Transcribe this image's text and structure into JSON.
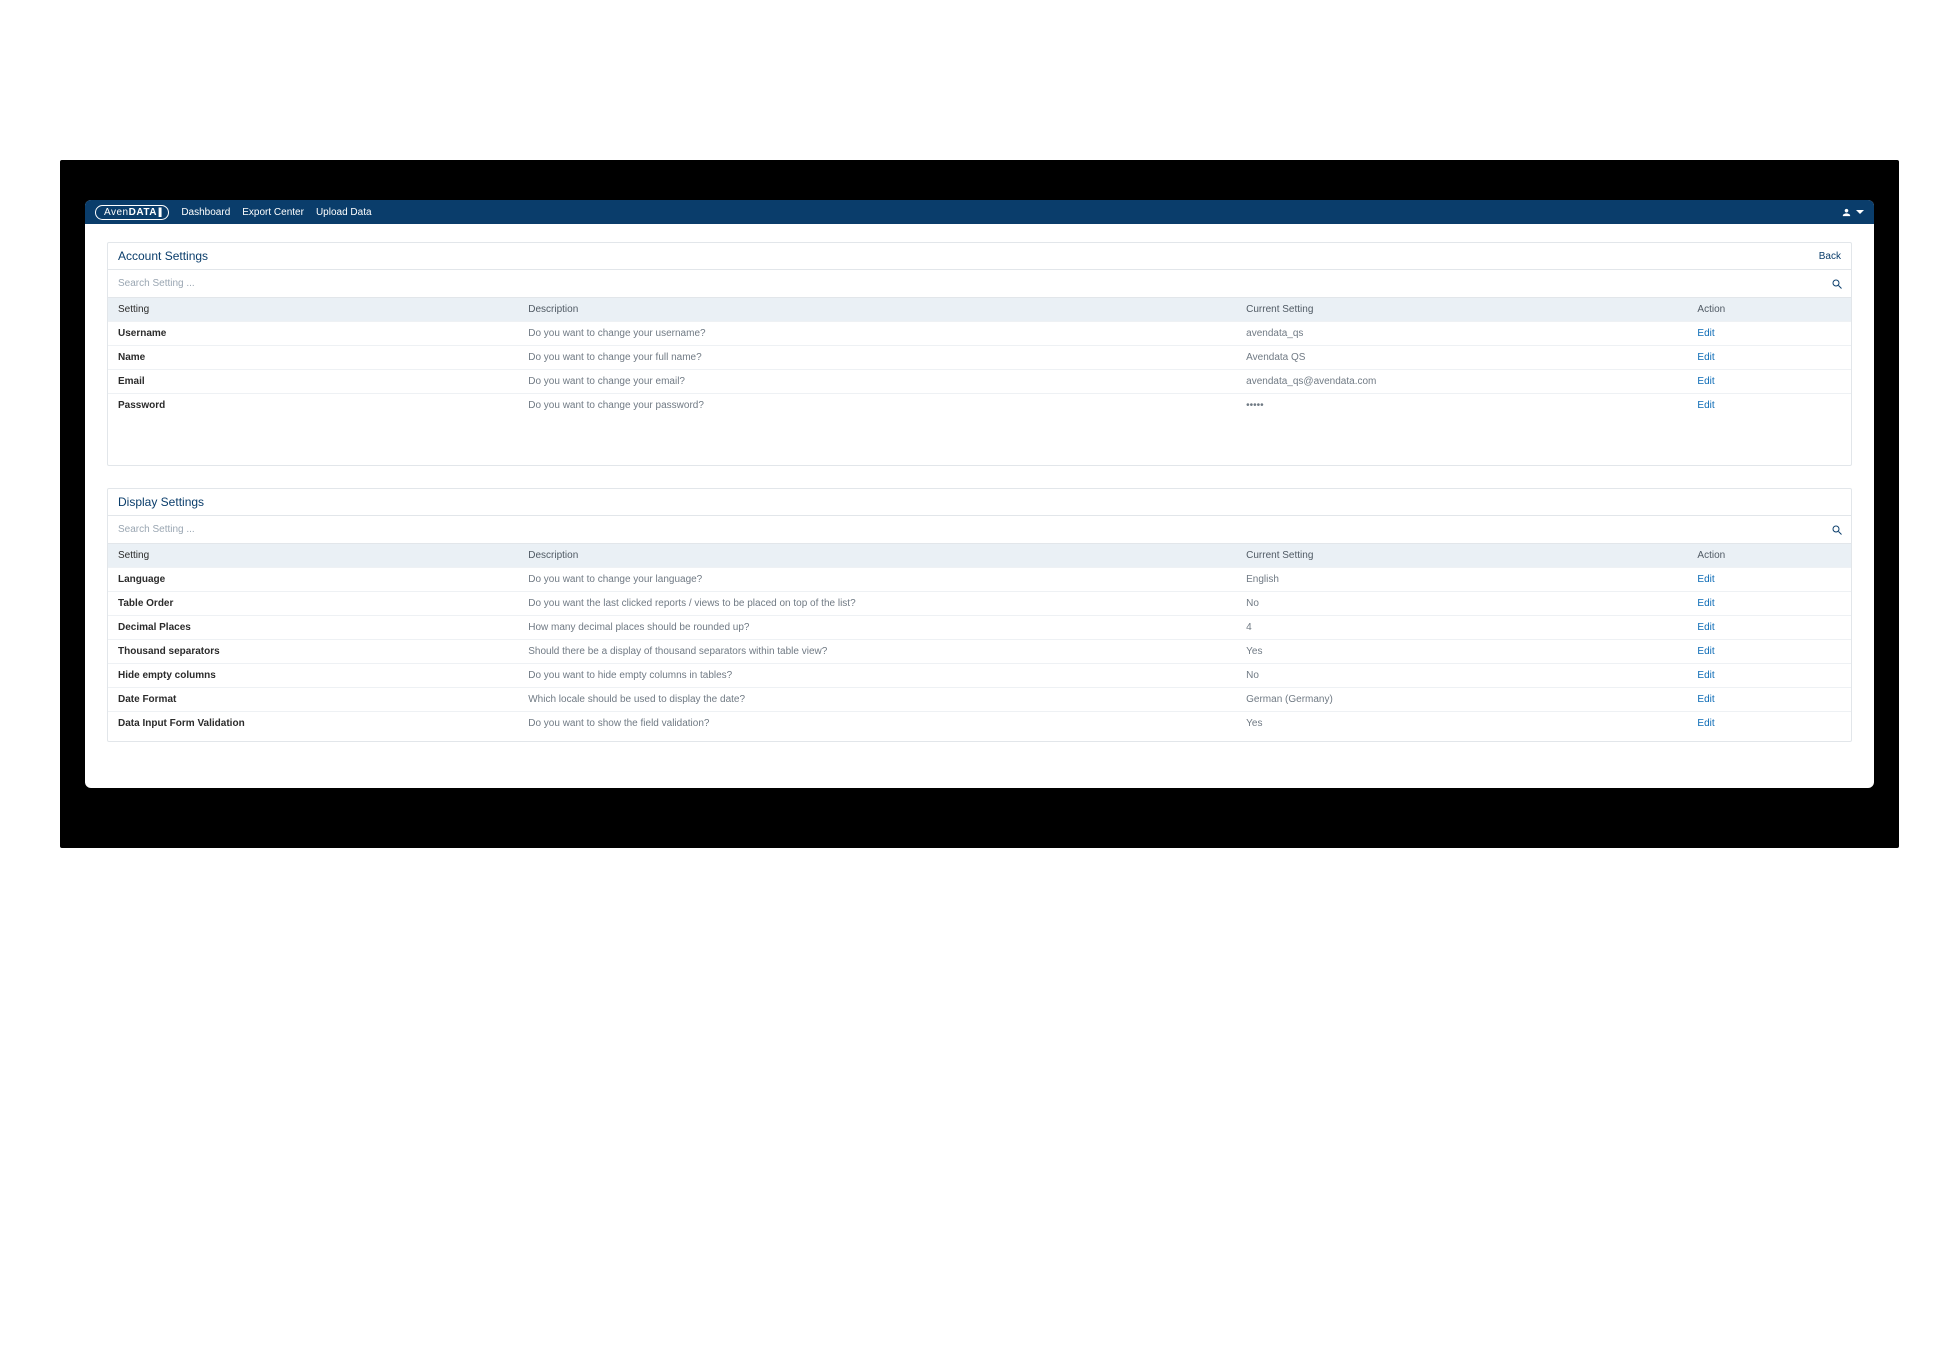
{
  "brand": {
    "prefix": "Aven",
    "bold": "DATA",
    "bars": "|||"
  },
  "nav": {
    "dashboard": "Dashboard",
    "export": "Export Center",
    "upload": "Upload Data"
  },
  "back_label": "Back",
  "search_placeholder": "Search Setting ...",
  "columns": {
    "setting": "Setting",
    "description": "Description",
    "current": "Current Setting",
    "action": "Action"
  },
  "edit_label": "Edit",
  "panels": {
    "account": {
      "title": "Account Settings",
      "rows": [
        {
          "setting": "Username",
          "description": "Do you want to change your username?",
          "current": "avendata_qs"
        },
        {
          "setting": "Name",
          "description": "Do you want to change your full name?",
          "current": "Avendata QS"
        },
        {
          "setting": "Email",
          "description": "Do you want to change your email?",
          "current": "avendata_qs@avendata.com"
        },
        {
          "setting": "Password",
          "description": "Do you want to change your password?",
          "current": "•••••"
        }
      ]
    },
    "display": {
      "title": "Display Settings",
      "rows": [
        {
          "setting": "Language",
          "description": "Do you want to change your language?",
          "current": "English"
        },
        {
          "setting": "Table Order",
          "description": "Do you want the last clicked reports / views to be placed on top of the list?",
          "current": "No"
        },
        {
          "setting": "Decimal Places",
          "description": "How many decimal places should be rounded up?",
          "current": "4"
        },
        {
          "setting": "Thousand separators",
          "description": "Should there be a display of thousand separators within table view?",
          "current": "Yes"
        },
        {
          "setting": "Hide empty columns",
          "description": "Do you want to hide empty columns in tables?",
          "current": "No"
        },
        {
          "setting": "Date Format",
          "description": "Which locale should be used to display the date?",
          "current": "German (Germany)"
        },
        {
          "setting": "Data Input Form Validation",
          "description": "Do you want to show the field validation?",
          "current": "Yes"
        }
      ]
    }
  }
}
